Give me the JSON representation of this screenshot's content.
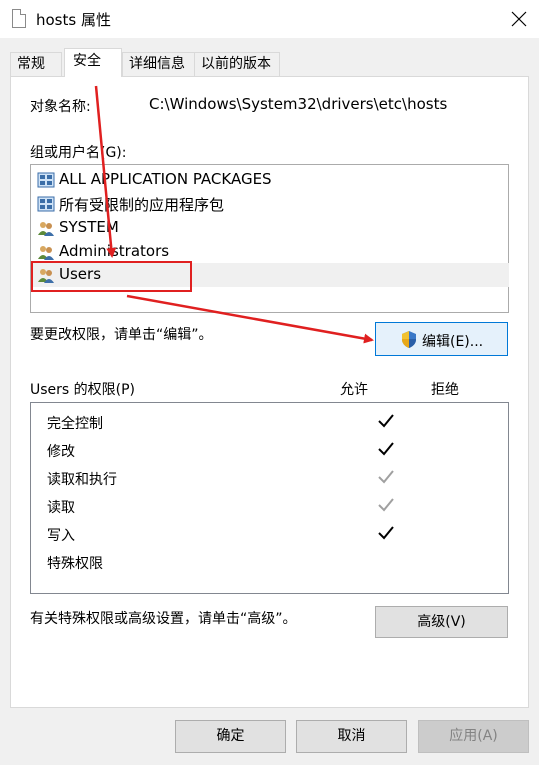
{
  "window": {
    "title": "hosts 属性",
    "icon": "document-icon"
  },
  "tabs": [
    {
      "label": "常规",
      "active": false
    },
    {
      "label": "安全",
      "active": true
    },
    {
      "label": "详细信息",
      "active": false
    },
    {
      "label": "以前的版本",
      "active": false
    }
  ],
  "security": {
    "object_label": "对象名称:",
    "object_path": "C:\\Windows\\System32\\drivers\\etc\\hosts",
    "groups_label": "组或用户名(G):",
    "groups": [
      {
        "name": "ALL APPLICATION PACKAGES",
        "icon": "package-icon",
        "selected": false
      },
      {
        "name": "所有受限制的应用程序包",
        "icon": "package-icon",
        "selected": false
      },
      {
        "name": "SYSTEM",
        "icon": "users-icon",
        "selected": false
      },
      {
        "name": "Administrators",
        "icon": "users-icon",
        "selected": false
      },
      {
        "name": "Users",
        "icon": "users-icon",
        "selected": true
      }
    ],
    "change_hint": "要更改权限，请单击“编辑”。",
    "edit_button": "编辑(E)...",
    "permissions_label": "Users 的权限(P)",
    "allow_header": "允许",
    "deny_header": "拒绝",
    "permissions": [
      {
        "name": "完全控制",
        "allow": "checked"
      },
      {
        "name": "修改",
        "allow": "checked"
      },
      {
        "name": "读取和执行",
        "allow": "grayed"
      },
      {
        "name": "读取",
        "allow": "grayed"
      },
      {
        "name": "写入",
        "allow": "checked"
      },
      {
        "name": "特殊权限",
        "allow": "none"
      }
    ],
    "advanced_hint": "有关特殊权限或高级设置，请单击“高级”。",
    "advanced_button": "高级(V)"
  },
  "footer": {
    "ok": "确定",
    "cancel": "取消",
    "apply": "应用(A)"
  },
  "colors": {
    "annotation_red": "#e02020",
    "check_black": "#000000",
    "check_gray": "#a0a0a0",
    "focus_blue": "#0078d7"
  }
}
